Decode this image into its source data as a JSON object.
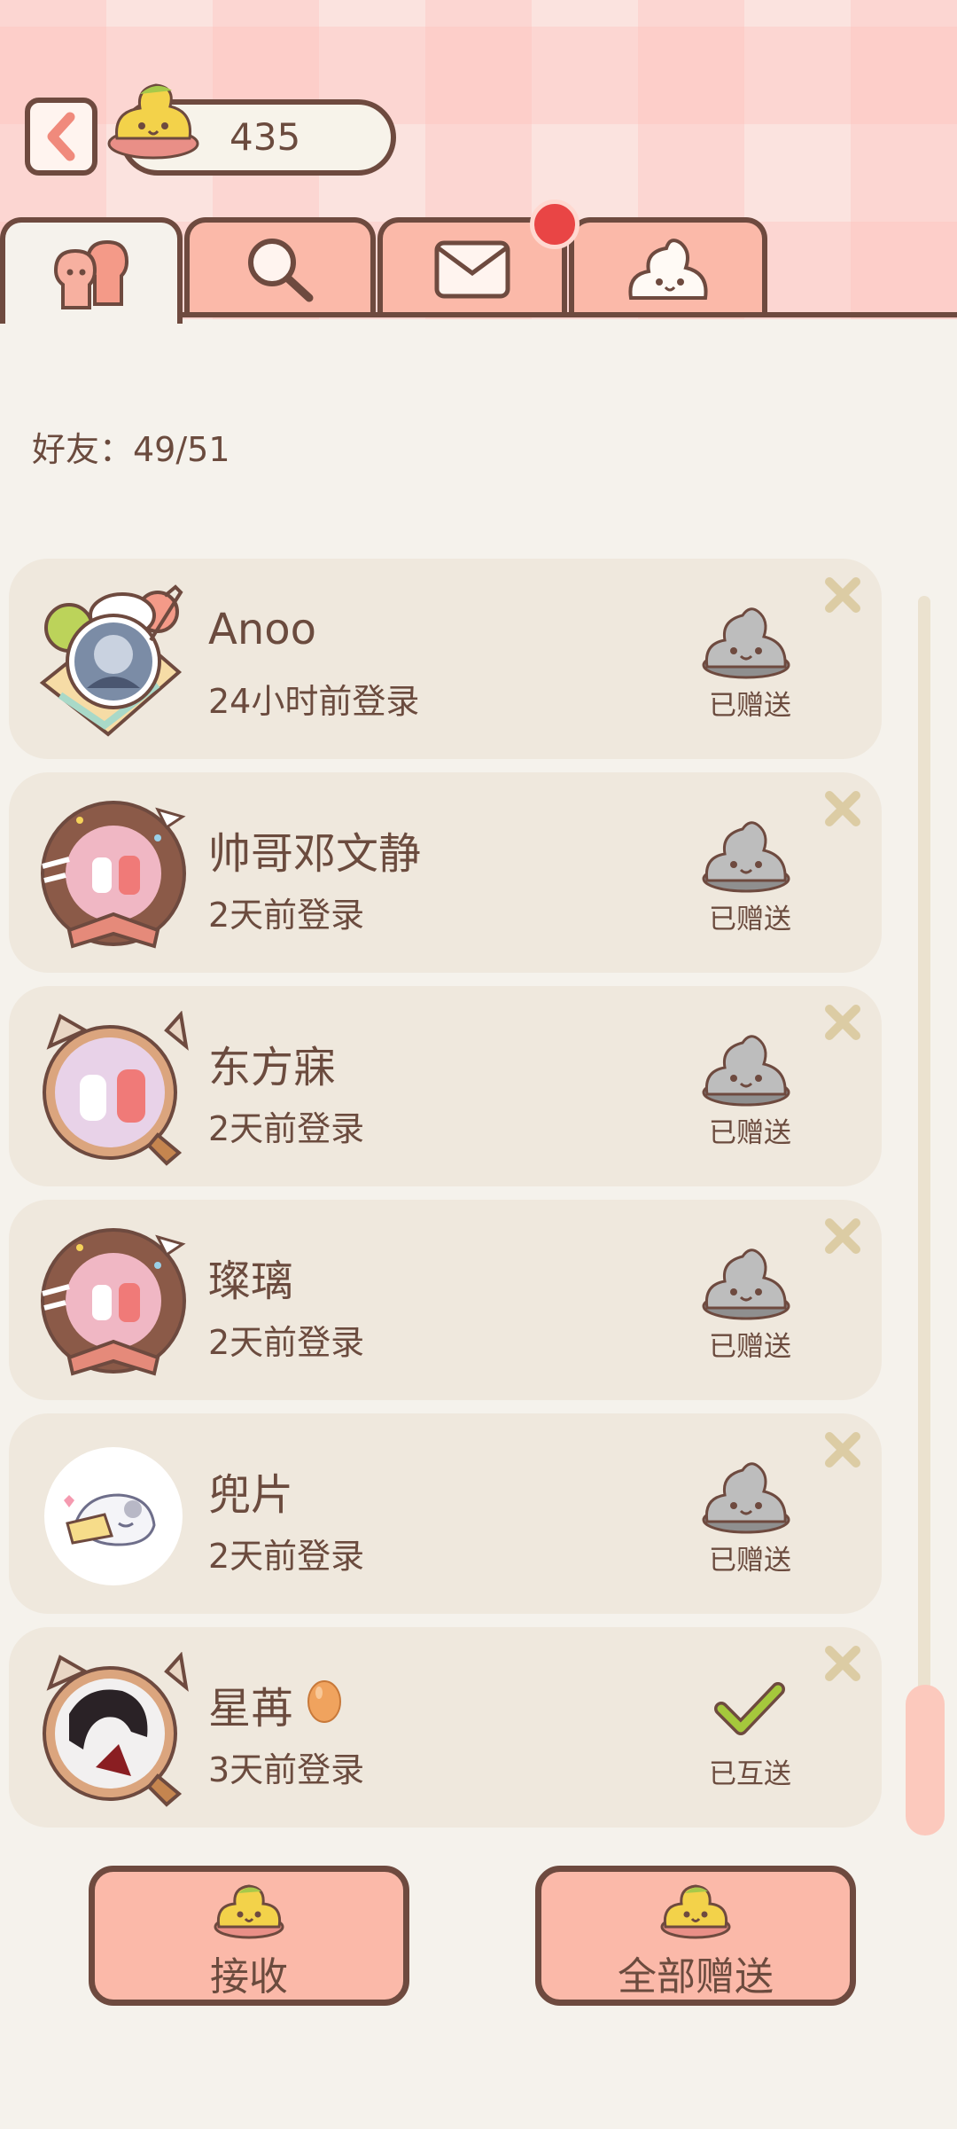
{
  "header": {
    "coin_count": "435",
    "back_icon": "chevron-left-icon",
    "coin_icon": "yellow-poop-icon"
  },
  "tabs": [
    {
      "name": "friends",
      "icon": "two-people-icon",
      "active": true
    },
    {
      "name": "search",
      "icon": "search-icon",
      "active": false
    },
    {
      "name": "mail",
      "icon": "envelope-icon",
      "active": false,
      "has_notification": true
    },
    {
      "name": "pet",
      "icon": "white-poop-icon",
      "active": false
    }
  ],
  "friends": {
    "count_label": "好友：49/51"
  },
  "friend_list": [
    {
      "name": "Anoo",
      "last_login": "24小时前登录",
      "status": "已赠送",
      "status_icon": "gray-poop-icon",
      "avatar_frame": "crepe"
    },
    {
      "name": "帅哥邓文静",
      "last_login": "2天前登录",
      "status": "已赠送",
      "status_icon": "gray-poop-icon",
      "avatar_frame": "donut"
    },
    {
      "name": "东方寐",
      "last_login": "2天前登录",
      "status": "已赠送",
      "status_icon": "gray-poop-icon",
      "avatar_frame": "cat-ears"
    },
    {
      "name": "璨璃",
      "last_login": "2天前登录",
      "status": "已赠送",
      "status_icon": "gray-poop-icon",
      "avatar_frame": "donut"
    },
    {
      "name": "兜片",
      "last_login": "2天前登录",
      "status": "已赠送",
      "status_icon": "gray-poop-icon",
      "avatar_frame": "plain"
    },
    {
      "name": "星苒",
      "last_login": "3天前登录",
      "status": "已互送",
      "status_icon": "checkmark-icon",
      "avatar_frame": "cat-ears",
      "badge_icon": "egg-icon"
    }
  ],
  "actions": {
    "receive_label": "接收",
    "send_all_label": "全部赠送"
  },
  "colors": {
    "background": "#f5f2ec",
    "card": "#efe8dd",
    "tab": "#fbb9a9",
    "outline": "#6e4a3f",
    "text": "#6b4b3e",
    "notification": "#e94545",
    "check": "#a5c83c"
  }
}
